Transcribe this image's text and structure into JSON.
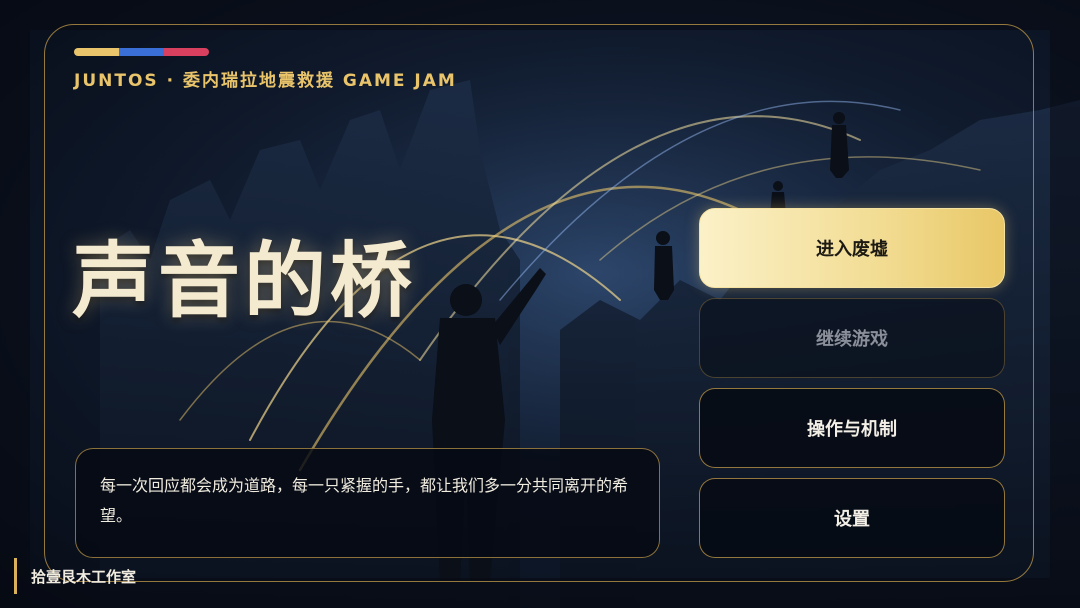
{
  "header": {
    "accent_colors": [
      "#e9c46a",
      "#3b6fd8",
      "#d9405f"
    ],
    "jam_tag": "JUNTOS · 委内瑞拉地震救援 GAME JAM"
  },
  "title": {
    "text": "声音的桥"
  },
  "tagline": {
    "text": "每一次回应都会成为道路，每一只紧握的手，都让我们多一分共同离开的希望。"
  },
  "menu": {
    "items": [
      {
        "label": "进入废墟",
        "state": "primary"
      },
      {
        "label": "继续游戏",
        "state": "disabled"
      },
      {
        "label": "操作与机制",
        "state": "normal"
      },
      {
        "label": "设置",
        "state": "normal"
      }
    ]
  },
  "footer": {
    "studio": "拾壹艮木工作室"
  },
  "theme": {
    "gold": "#c49c4a",
    "panel": "#060a14",
    "primary_button": "#f2dc92"
  }
}
